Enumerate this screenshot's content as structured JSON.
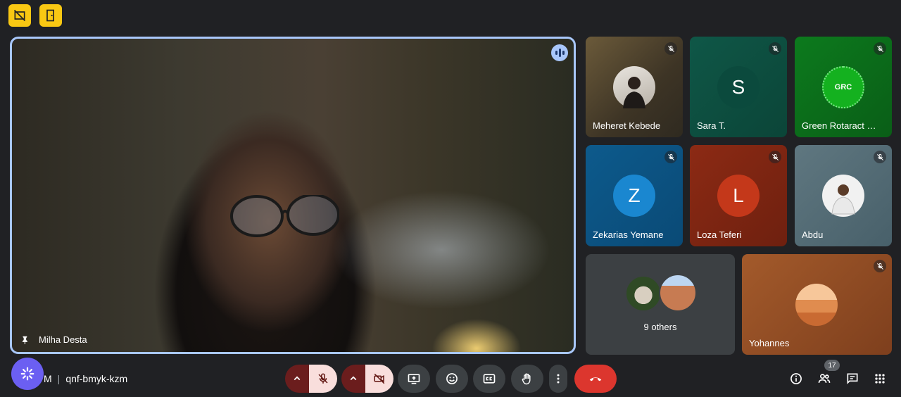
{
  "top_buttons": [
    {
      "icon": "no-photography-icon"
    },
    {
      "icon": "exit-door-icon"
    }
  ],
  "main_tile": {
    "participant": "Milha Desta",
    "speaking": true
  },
  "tiles": [
    {
      "name": "Meheret Kebede",
      "muted": true,
      "avatar": "photo"
    },
    {
      "name": "Sara T.",
      "muted": true,
      "initial": "S"
    },
    {
      "name": "Green Rotaract …",
      "muted": true,
      "avatar": "logo",
      "logo_text": "GRC"
    },
    {
      "name": "Zekarias Yemane",
      "muted": true,
      "initial": "Z"
    },
    {
      "name": "Loza Teferi",
      "muted": true,
      "initial": "L"
    },
    {
      "name": "Abdu",
      "muted": true,
      "avatar": "photo"
    },
    {
      "name": "Yohannes",
      "muted": true,
      "avatar": "landscape"
    }
  ],
  "others_tile": {
    "label": "9 others"
  },
  "meeting": {
    "time_fragment": "M",
    "code": "qnf-bmyk-kzm"
  },
  "people_count": "17",
  "colors": {
    "accent": "#a8c7fa",
    "hangup": "#dc362e",
    "mic_off_bg": "#f9dedc",
    "top_button": "#f9c813"
  }
}
